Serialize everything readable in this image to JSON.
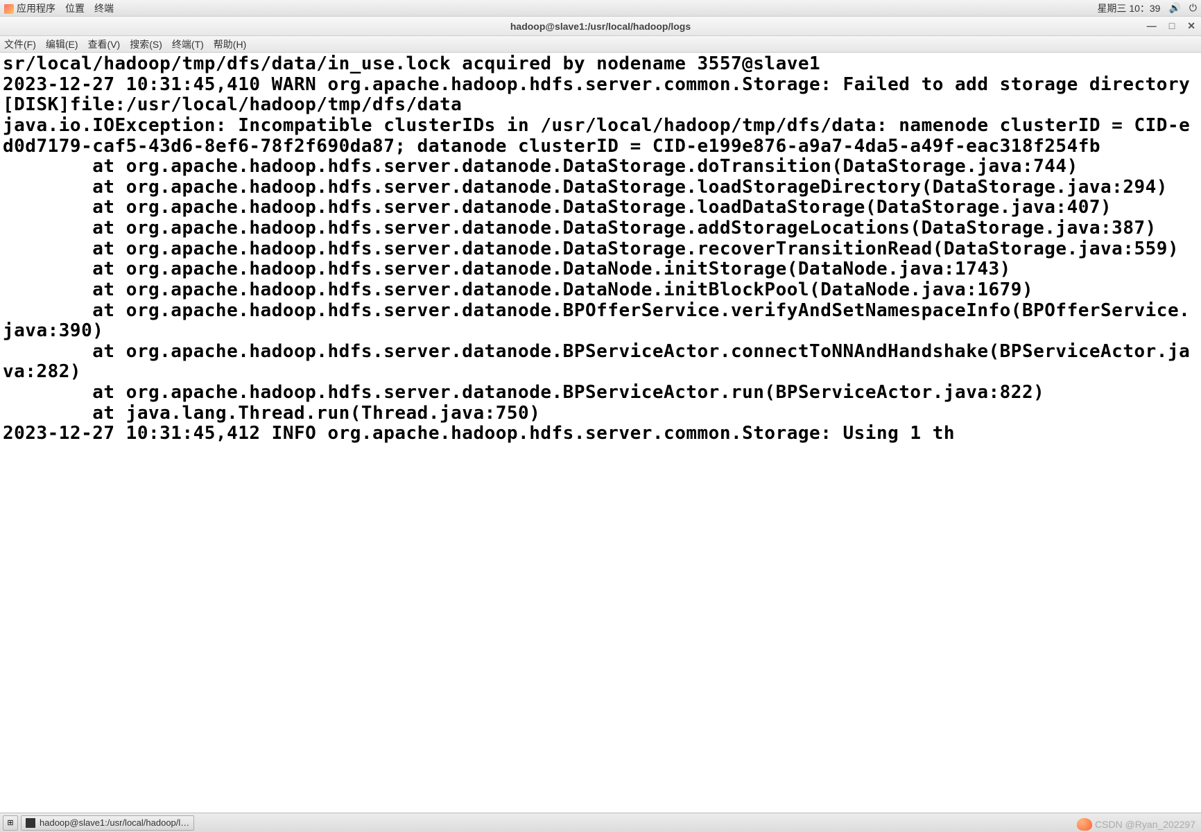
{
  "top_panel": {
    "apps": "应用程序",
    "places": "位置",
    "terminal": "终端",
    "datetime": "星期三 10：39"
  },
  "window": {
    "title": "hadoop@slave1:/usr/local/hadoop/logs"
  },
  "menubar": {
    "file": "文件(F)",
    "edit": "编辑(E)",
    "view": "查看(V)",
    "search": "搜索(S)",
    "terminal": "终端(T)",
    "help": "帮助(H)"
  },
  "terminal_content": "sr/local/hadoop/tmp/dfs/data/in_use.lock acquired by nodename 3557@slave1\n2023-12-27 10:31:45,410 WARN org.apache.hadoop.hdfs.server.common.Storage: Failed to add storage directory [DISK]file:/usr/local/hadoop/tmp/dfs/data\njava.io.IOException: Incompatible clusterIDs in /usr/local/hadoop/tmp/dfs/data: namenode clusterID = CID-ed0d7179-caf5-43d6-8ef6-78f2f690da87; datanode clusterID = CID-e199e876-a9a7-4da5-a49f-eac318f254fb\n        at org.apache.hadoop.hdfs.server.datanode.DataStorage.doTransition(DataStorage.java:744)\n        at org.apache.hadoop.hdfs.server.datanode.DataStorage.loadStorageDirectory(DataStorage.java:294)\n        at org.apache.hadoop.hdfs.server.datanode.DataStorage.loadDataStorage(DataStorage.java:407)\n        at org.apache.hadoop.hdfs.server.datanode.DataStorage.addStorageLocations(DataStorage.java:387)\n        at org.apache.hadoop.hdfs.server.datanode.DataStorage.recoverTransitionRead(DataStorage.java:559)\n        at org.apache.hadoop.hdfs.server.datanode.DataNode.initStorage(DataNode.java:1743)\n        at org.apache.hadoop.hdfs.server.datanode.DataNode.initBlockPool(DataNode.java:1679)\n        at org.apache.hadoop.hdfs.server.datanode.BPOfferService.verifyAndSetNamespaceInfo(BPOfferService.java:390)\n        at org.apache.hadoop.hdfs.server.datanode.BPServiceActor.connectToNNAndHandshake(BPServiceActor.java:282)\n        at org.apache.hadoop.hdfs.server.datanode.BPServiceActor.run(BPServiceActor.java:822)\n        at java.lang.Thread.run(Thread.java:750)\n2023-12-27 10:31:45,412 INFO org.apache.hadoop.hdfs.server.common.Storage: Using 1 th",
  "taskbar": {
    "task_label": "hadoop@slave1:/usr/local/hadoop/l…"
  },
  "watermark": {
    "text": "CSDN @Ryan_202297"
  }
}
